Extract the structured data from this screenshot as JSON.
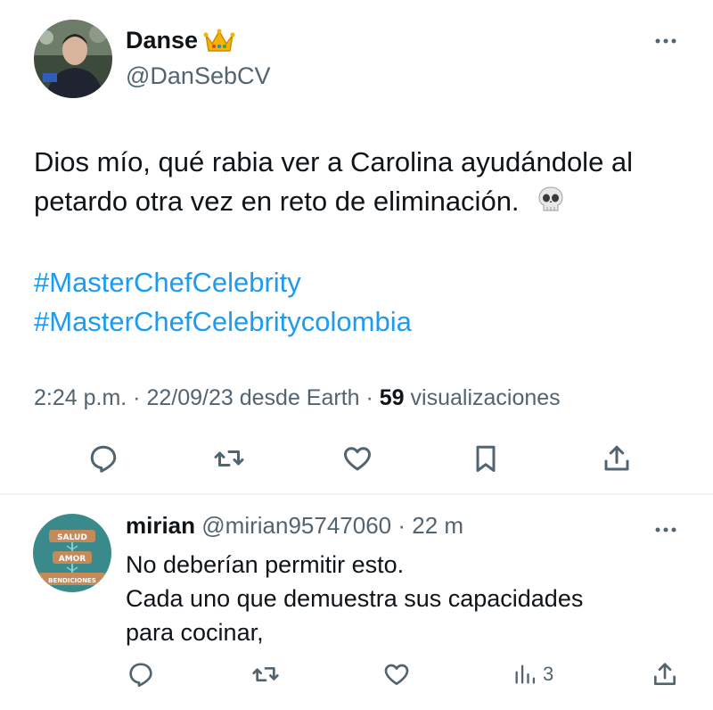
{
  "main_tweet": {
    "author_name": "Danse",
    "author_emoji": "crown-icon",
    "author_handle": "@DanSebCV",
    "text_lines": [
      "Dios mío, qué rabia ver a Carolina ayudándole al",
      "petardo otra vez en reto de eliminación."
    ],
    "text_emoji": "skull-icon",
    "hashtags": [
      "#MasterChefCelebrity",
      "#MasterChefCelebritycolombia"
    ],
    "time": "2:24 p.m.",
    "sep1": " · ",
    "date": "22/09/23",
    "source": " desde Earth",
    "sep2": " · ",
    "views_count": "59",
    "views_label": " visualizaciones",
    "actions": [
      "reply-icon",
      "retweet-icon",
      "like-icon",
      "bookmark-icon",
      "share-icon"
    ]
  },
  "reply": {
    "author_name": "mirian",
    "author_handle": "@mirian95747060",
    "sep": " · ",
    "time": "22 m",
    "avatar_text": [
      "SALUD",
      "AMOR",
      "BENDICIONES"
    ],
    "text_lines": [
      "No deberían permitir esto.",
      "Cada uno que demuestra sus capacidades",
      "para cocinar,"
    ],
    "views": "3",
    "actions": [
      "reply-icon",
      "retweet-icon",
      "like-icon",
      "views-icon",
      "share-icon"
    ]
  },
  "colors": {
    "link": "#1d9bf0",
    "secondary": "#536471",
    "primary": "#0f1419",
    "divider": "#eff3f4"
  }
}
